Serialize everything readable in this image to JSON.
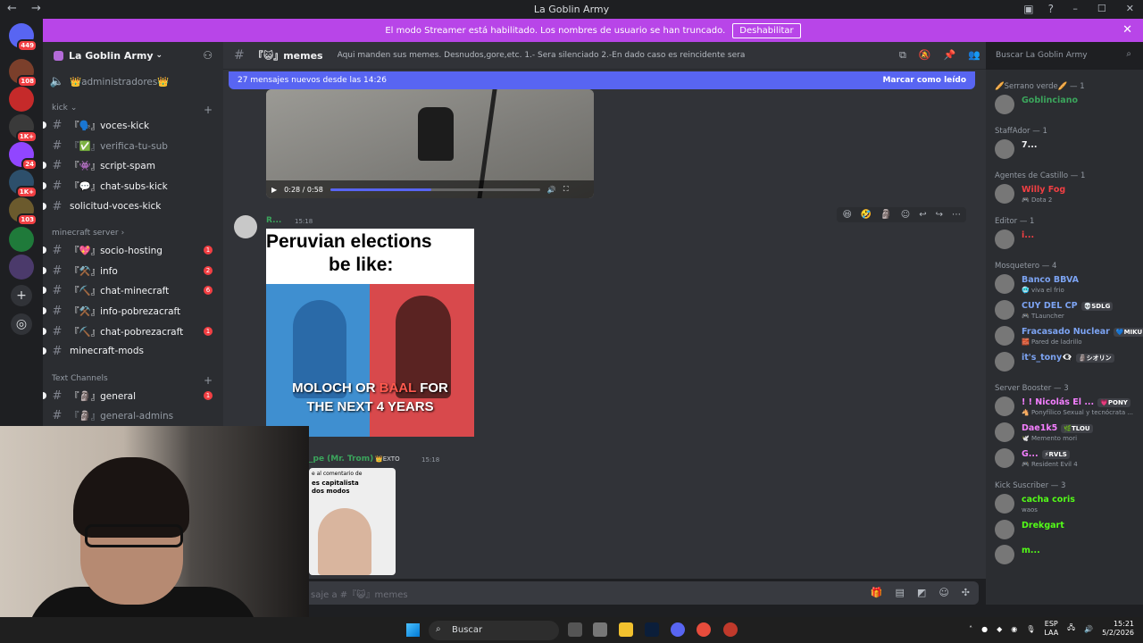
{
  "window": {
    "title": "La Goblin Army",
    "back": "←",
    "forward": "→",
    "controls": [
      "–",
      "☐",
      "✕"
    ]
  },
  "banner": {
    "text": "El modo Streamer está habilitado. Los nombres de usuario se han truncado.",
    "button": "Deshabilitar",
    "close": "✕"
  },
  "servers": {
    "badges": [
      "449",
      "108",
      "1K+",
      "1K+",
      "24",
      "1K+",
      "103"
    ]
  },
  "sidebar": {
    "server_name": "La Goblin Army",
    "channels_top": [
      {
        "name": "👑administradores👑"
      }
    ],
    "categories": [
      {
        "name": "kick",
        "channels": [
          {
            "name": "『🗣️』voces-kick",
            "unread": true
          },
          {
            "name": "『✅』verifica-tu-sub",
            "unread": false
          },
          {
            "name": "『👾』script-spam",
            "unread": true
          },
          {
            "name": "『💬』chat-subs-kick",
            "unread": true
          },
          {
            "name": "solicitud-voces-kick",
            "unread": true
          }
        ]
      },
      {
        "name": "minecraft server",
        "channels": [
          {
            "name": "『💖』socio-hosting",
            "badge": "1"
          },
          {
            "name": "『⚒️』info",
            "badge": "2"
          },
          {
            "name": "『⛏️』chat-minecraft",
            "badge": "6"
          },
          {
            "name": "『⚒️』info-pobrezacraft",
            "badge": ""
          },
          {
            "name": "『⛏️』chat-pobrezacraft",
            "badge": "1"
          },
          {
            "name": "minecraft-mods",
            "badge": ""
          }
        ]
      },
      {
        "name": "Text Channels",
        "channels": [
          {
            "name": "『🗿』general",
            "badge": "1"
          },
          {
            "name": "『🗿』general-admins",
            "badge": ""
          }
        ]
      }
    ]
  },
  "channel": {
    "name": "『😺』memes",
    "topic": "Aqui manden sus memes. Desnudos,gore,etc. 1.- Sera silenciado 2.-En dado caso es reincidente sera baneado",
    "search_placeholder": "Buscar La Goblin Army"
  },
  "newbar": {
    "text": "27 mensajes nuevos desde las 14:26",
    "action": "Marcar como leído"
  },
  "video": {
    "time": "0:28 / 0:58",
    "progress": 0.48
  },
  "messages": [
    {
      "author": "R...",
      "time": "15:18",
      "meme": {
        "top_line1": "Peruvian  elections",
        "top_line2": "be like:",
        "caption_a": "MOLOCH",
        "caption_or": " OR ",
        "caption_b": "BAAL",
        "caption_c": " FOR",
        "caption_line2": "THE NEXT 4 YEARS"
      }
    },
    {
      "author": "_pe (Mr. Trom)",
      "tag": "👑EXTO",
      "time": "15:18",
      "thumb_line1": "e al comentario de",
      "thumb_line2": "es capitalista",
      "thumb_line3": "dos modos"
    }
  ],
  "composer": {
    "placeholder": "saje a #『😺』memes"
  },
  "members": [
    {
      "role": "🥖Serrano verde🥖 — 1",
      "items": [
        {
          "name": "Goblinciano",
          "color": "#3ba55c",
          "status": ""
        }
      ]
    },
    {
      "role": "StaffAdor — 1",
      "items": [
        {
          "name": "7...",
          "color": "#f2f3f5",
          "status": ""
        }
      ]
    },
    {
      "role": "Agentes de Castillo — 1",
      "items": [
        {
          "name": "Willy Fog",
          "color": "#f23f43",
          "status": "🎮 Dota 2"
        }
      ]
    },
    {
      "role": "Editor — 1",
      "items": [
        {
          "name": "i...",
          "color": "#f23f43",
          "status": ""
        }
      ]
    },
    {
      "role": "Mosquetero — 4",
      "items": [
        {
          "name": "Banco BBVA",
          "color": "#7ca3f2",
          "status": "🥶 viva el frio"
        },
        {
          "name": "CUY DEL CP",
          "color": "#7ca3f2",
          "status": "🎮 TLauncher",
          "tag": "💀SDLG"
        },
        {
          "name": "Fracasado Nuclear",
          "color": "#7ca3f2",
          "status": "🧱 Pared de ladrillo",
          "tag": "💙MIKU"
        },
        {
          "name": "it's_tony👁️‍🗨️",
          "color": "#7ca3f2",
          "status": "",
          "tag": "🗿シオリン"
        }
      ]
    },
    {
      "role": "Server Booster — 3",
      "items": [
        {
          "name": "! ! Nicolás El ...",
          "color": "#f47fff",
          "status": "🐴 Ponyfílico Sexual y tecnócrata ...",
          "tag": "💗PONY"
        },
        {
          "name": "Dae1k5",
          "color": "#f47fff",
          "status": "🕊️ Memento mori",
          "tag": "🌿TLOU"
        },
        {
          "name": "G...",
          "color": "#f47fff",
          "status": "🎮 Resident Evil 4",
          "tag": "⚡RVLS"
        }
      ]
    },
    {
      "role": "Kick Suscriber — 3",
      "items": [
        {
          "name": "cacha coris",
          "color": "#53fc18",
          "status": "waos"
        },
        {
          "name": "Drekgart",
          "color": "#53fc18",
          "status": ""
        },
        {
          "name": "m...",
          "color": "#53fc18",
          "status": ""
        }
      ]
    }
  ],
  "taskbar": {
    "search": "Buscar",
    "lang": "ESP",
    "lang2": "LAA",
    "time": "15:21",
    "date": "5/2/2026"
  }
}
